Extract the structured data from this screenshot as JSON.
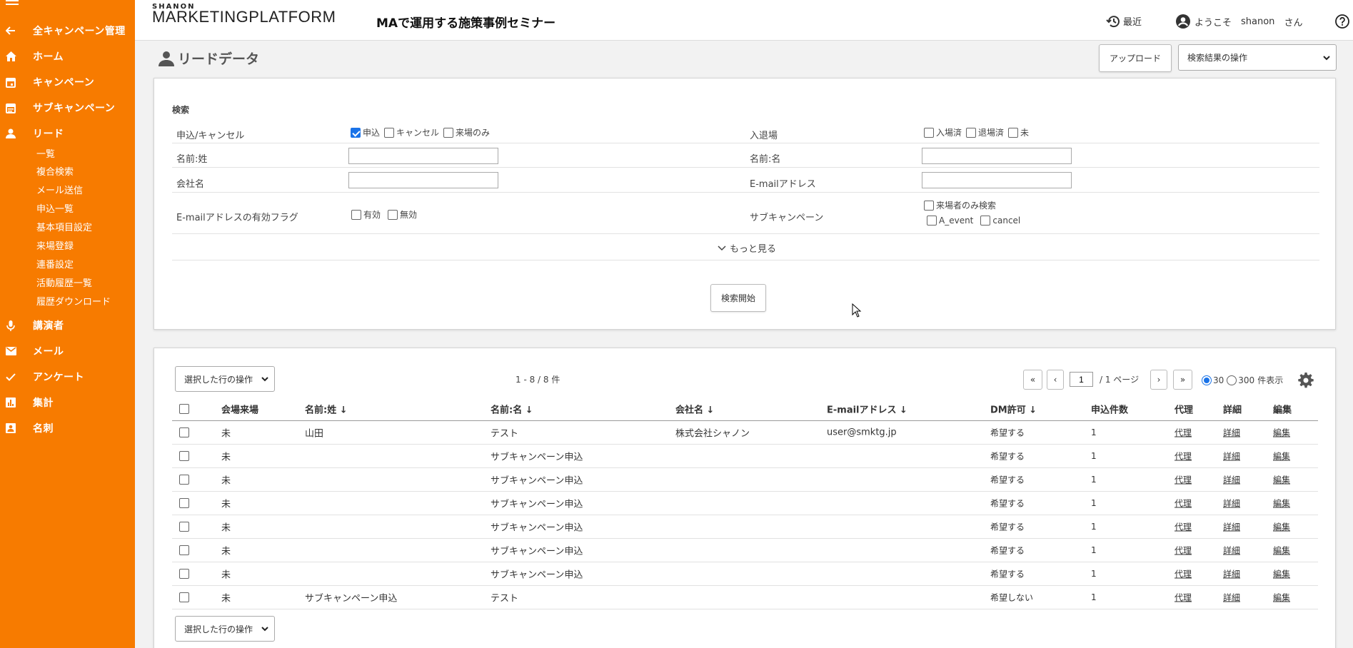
{
  "app": {
    "brand_small": "SHANON",
    "brand_big_bold": "MARKETING",
    "brand_big_regular": "PLATFORM",
    "seminar_title": "MAで運用する施策事例セミナー",
    "recent_label": "最近",
    "welcome_label": "ようこそ",
    "user_name": "shanon",
    "user_suffix": "さん"
  },
  "sidebar": {
    "back_label": "全キャンペーン管理",
    "items": [
      {
        "label": "ホーム",
        "icon": "home-icon"
      },
      {
        "label": "キャンペーン",
        "icon": "calendar-icon"
      },
      {
        "label": "サブキャンペーン",
        "icon": "calendar-list-icon"
      },
      {
        "label": "リード",
        "icon": "person-icon"
      }
    ],
    "lead_sub_items": [
      "一覧",
      "複合検索",
      "メール送信",
      "申込一覧",
      "基本項目設定",
      "来場登録",
      "連番設定",
      "活動履歴一覧",
      "履歴ダウンロード"
    ],
    "items_after": [
      {
        "label": "講演者",
        "icon": "microphone-icon"
      },
      {
        "label": "メール",
        "icon": "mail-icon"
      },
      {
        "label": "アンケート",
        "icon": "check-icon"
      },
      {
        "label": "集計",
        "icon": "bar-chart-icon"
      },
      {
        "label": "名刺",
        "icon": "business-card-icon"
      }
    ]
  },
  "page": {
    "title": "リードデータ",
    "upload_label": "アップロード",
    "search_ops_label": "検索結果の操作"
  },
  "search": {
    "section_title": "検索",
    "apply_cancel_label": "申込/キャンセル",
    "apply_options": [
      {
        "label": "申込",
        "checked": true
      },
      {
        "label": "キャンセル",
        "checked": false
      },
      {
        "label": "来場のみ",
        "checked": false
      }
    ],
    "entry_exit_label": "入退場",
    "entry_options": [
      {
        "label": "入場済",
        "checked": false
      },
      {
        "label": "退場済",
        "checked": false
      },
      {
        "label": "未",
        "checked": false
      }
    ],
    "last_name_label": "名前:姓",
    "last_name_value": "",
    "first_name_label": "名前:名",
    "first_name_value": "",
    "company_label": "会社名",
    "company_value": "",
    "email_label": "E-mailアドレス",
    "email_value": "",
    "email_flag_label": "E-mailアドレスの有効フラグ",
    "email_flag_options": [
      {
        "label": "有効",
        "checked": false
      },
      {
        "label": "無効",
        "checked": false
      }
    ],
    "subcampaign_label": "サブキャンペーン",
    "visitor_only_label": "来場者のみ検索",
    "subcampaign_options": [
      {
        "label": "A_event",
        "checked": false
      },
      {
        "label": "cancel",
        "checked": false
      }
    ],
    "more_label": "もっと見る",
    "start_label": "検索開始"
  },
  "results": {
    "row_ops_label": "選択した行の操作",
    "count_text": "1 - 8 / 8 件",
    "page_value": "1",
    "page_total_text": "/ 1 ページ",
    "first_label": "«",
    "prev_label": "‹",
    "next_label": "›",
    "last_label": "»",
    "per_page_30": "30",
    "per_page_300": "300",
    "per_page_suffix": "件表示",
    "per_page_selected": "30",
    "columns": [
      "会場来場",
      "名前:姓 ↓",
      "名前:名 ↓",
      "会社名 ↓",
      "E-mailアドレス ↓",
      "DM許可 ↓",
      "申込件数",
      "代理",
      "詳細",
      "編集"
    ],
    "rows": [
      {
        "attend": "未",
        "last": "山田",
        "first": "テスト",
        "company": "株式会社シャノン",
        "email": "user@smktg.jp",
        "dm": "希望する",
        "count": "1",
        "proxy": "代理",
        "detail": "詳細",
        "edit": "編集"
      },
      {
        "attend": "未",
        "last": "",
        "first": "サブキャンペーン申込",
        "company": "",
        "email": "",
        "dm": "希望する",
        "count": "1",
        "proxy": "代理",
        "detail": "詳細",
        "edit": "編集"
      },
      {
        "attend": "未",
        "last": "",
        "first": "サブキャンペーン申込",
        "company": "",
        "email": "",
        "dm": "希望する",
        "count": "1",
        "proxy": "代理",
        "detail": "詳細",
        "edit": "編集"
      },
      {
        "attend": "未",
        "last": "",
        "first": "サブキャンペーン申込",
        "company": "",
        "email": "",
        "dm": "希望する",
        "count": "1",
        "proxy": "代理",
        "detail": "詳細",
        "edit": "編集"
      },
      {
        "attend": "未",
        "last": "",
        "first": "サブキャンペーン申込",
        "company": "",
        "email": "",
        "dm": "希望する",
        "count": "1",
        "proxy": "代理",
        "detail": "詳細",
        "edit": "編集"
      },
      {
        "attend": "未",
        "last": "",
        "first": "サブキャンペーン申込",
        "company": "",
        "email": "",
        "dm": "希望する",
        "count": "1",
        "proxy": "代理",
        "detail": "詳細",
        "edit": "編集"
      },
      {
        "attend": "未",
        "last": "",
        "first": "サブキャンペーン申込",
        "company": "",
        "email": "",
        "dm": "希望する",
        "count": "1",
        "proxy": "代理",
        "detail": "詳細",
        "edit": "編集"
      },
      {
        "attend": "未",
        "last": "サブキャンペーン申込",
        "first": "テスト",
        "company": "",
        "email": "",
        "dm": "希望しない",
        "count": "1",
        "proxy": "代理",
        "detail": "詳細",
        "edit": "編集"
      }
    ]
  },
  "colors": {
    "sidebar": "#f77b00",
    "accent": "#1a73e8"
  }
}
